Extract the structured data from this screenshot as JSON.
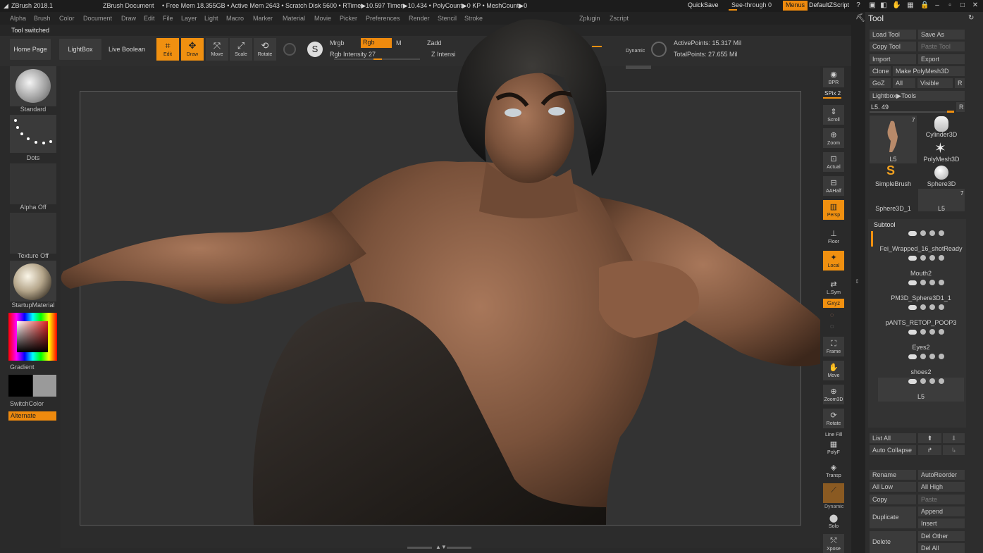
{
  "titlebar": {
    "app_name": "ZBrush 2018.1",
    "document": "ZBrush Document",
    "stats": "• Free Mem 18.355GB • Active Mem 2643 • Scratch Disk 5600 • RTime▶10.597 Timer▶10.434 • PolyCount▶0 KP • MeshCount▶0",
    "quicksave": "QuickSave",
    "see_through": "See-through  0",
    "menus": "Menus",
    "default_zscript": "DefaultZScript"
  },
  "menubar": [
    "Alpha",
    "Brush",
    "Color",
    "Document",
    "Draw",
    "Edit",
    "File",
    "Layer",
    "Light",
    "Macro",
    "Marker",
    "Material",
    "Movie",
    "Picker",
    "Preferences",
    "Render",
    "Stencil",
    "Stroke",
    "Zplugin",
    "Zscript"
  ],
  "status": "Tool switched",
  "shelf": {
    "home_page": "Home Page",
    "lightbox": "LightBox",
    "live_boolean": "Live Boolean",
    "edit": "Edit",
    "draw": "Draw",
    "move": "Move",
    "scale": "Scale",
    "rotate": "Rotate",
    "mrgb": "Mrgb",
    "rgb": "Rgb",
    "m": "M",
    "zadd": "Zadd",
    "rgb_intensity": "Rgb Intensity 27",
    "z_intensity": "Z Intensi",
    "dynamic": "Dynamic",
    "active_points": "ActivePoints: 15.317 Mil",
    "total_points": "TotalPoints: 27.655 Mil"
  },
  "lefttray": {
    "brush": "Standard",
    "stroke": "Dots",
    "alpha": "Alpha Off",
    "texture": "Texture Off",
    "material": "StartupMaterial",
    "gradient": "Gradient",
    "switchcolor": "SwitchColor",
    "alternate": "Alternate"
  },
  "navcol": {
    "bpr": "BPR",
    "spix": "SPix 2",
    "scroll": "Scroll",
    "zoom": "Zoom",
    "actual": "Actual",
    "aahalf": "AAHalf",
    "persp": "Persp",
    "floor": "Floor",
    "local": "Local",
    "lsym": "L.Sym",
    "gxyz": "Gxyz",
    "frame": "Frame",
    "move": "Move",
    "zoom3d": "Zoom3D",
    "rotate": "Rotate",
    "linefill": "Line Fill",
    "polyf": "PolyF",
    "transp": "Transp",
    "dynamic": "Dynamic",
    "solo": "Solo",
    "xpose": "Xpose"
  },
  "panel": {
    "title": "Tool",
    "load_tool": "Load Tool",
    "save_as": "Save As",
    "copy_tool": "Copy Tool",
    "paste_tool": "Paste Tool",
    "import": "Import",
    "export": "Export",
    "clone": "Clone",
    "make_polymesh": "Make PolyMesh3D",
    "goz": "GoZ",
    "all": "All",
    "visible": "Visible",
    "r": "R",
    "lightbox_tools": "Lightbox▶Tools",
    "l5_value": "L5. 49",
    "r2": "R",
    "tools": [
      {
        "name": "L5",
        "count": "7"
      },
      {
        "name": "Cylinder3D"
      },
      {
        "name": "PolyMesh3D"
      },
      {
        "name": "SimpleBrush"
      },
      {
        "name": "Sphere3D"
      },
      {
        "name": "Sphere3D_1"
      },
      {
        "name": "L5",
        "count": "7"
      }
    ],
    "subtool_title": "Subtool",
    "subtools": [
      "Fei_Wrapped_16_shotReady",
      "Mouth2",
      "PM3D_Sphere3D1_1",
      "pANTS_RETOP_POOP3",
      "Eyes2",
      "shoes2",
      "L5"
    ],
    "list_all": "List All",
    "auto_collapse": "Auto Collapse",
    "rename": "Rename",
    "auto_reorder": "AutoReorder",
    "all_low": "All Low",
    "all_high": "All High",
    "copy": "Copy",
    "paste": "Paste",
    "duplicate": "Duplicate",
    "append": "Append",
    "insert": "Insert",
    "delete": "Delete",
    "del_other": "Del Other",
    "del_all": "Del All"
  }
}
